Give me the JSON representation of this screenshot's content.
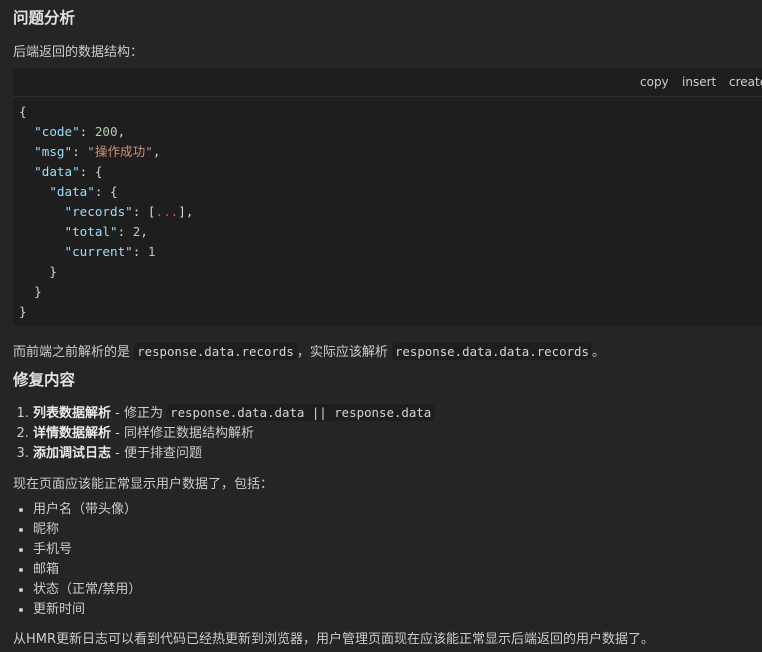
{
  "analysis": {
    "heading": "问题分析",
    "intro": "后端返回的数据结构："
  },
  "code_block": {
    "tools": {
      "copy": "copy",
      "insert": "insert",
      "create": "create"
    },
    "lines": {
      "l1": "{",
      "l2_key": "\"code\"",
      "l2_val": "200",
      "l3_key": "\"msg\"",
      "l3_val": "\"操作成功\"",
      "l4_key": "\"data\"",
      "l5_key": "\"data\"",
      "l6_key": "\"records\"",
      "l6_val": "...",
      "l7_key": "\"total\"",
      "l7_val": "2",
      "l8_key": "\"current\"",
      "l8_val": "1",
      "l9": "}",
      "l10": "}",
      "l11": "}"
    }
  },
  "explain": {
    "prefix": "而前端之前解析的是",
    "code1": "response.data.records",
    "middle": "，实际应该解析",
    "code2": "response.data.data.records",
    "suffix": "。"
  },
  "fix": {
    "heading": "修复内容",
    "items": [
      {
        "title": "列表数据解析",
        "desc": " - 修正为 ",
        "code": "response.data.data || response.data"
      },
      {
        "title": "详情数据解析",
        "desc": " - 同样修正数据结构解析"
      },
      {
        "title": "添加调试日志",
        "desc": " - 便于排查问题"
      }
    ]
  },
  "display": {
    "intro": "现在页面应该能正常显示用户数据了，包括：",
    "fields": [
      "用户名（带头像）",
      "昵称",
      "手机号",
      "邮箱",
      "状态（正常/禁用）",
      "更新时间"
    ]
  },
  "final": "从HMR更新日志可以看到代码已经热更新到浏览器，用户管理页面现在应该能正常显示后端返回的用户数据了。"
}
